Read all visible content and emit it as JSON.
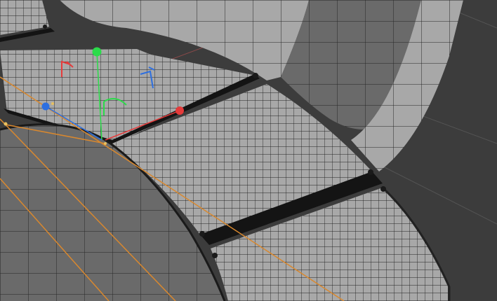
{
  "viewport": {
    "view": "3D perspective",
    "background_color": "#3c3c3c",
    "floor_grid_color": "#545454",
    "world_x_axis_color": "#8e4a4a"
  },
  "mesh": {
    "fill_color": "#a8a8a8",
    "dark_fill_color": "#6a6a6a",
    "wire_color": "#222222",
    "gap_color": "#141414"
  },
  "spline": {
    "color": "#d9882e",
    "point_color": "#e8c060"
  },
  "gizmo": {
    "x_axis_color": "#e53b3b",
    "y_axis_color": "#2bdb4a",
    "z_axis_color": "#2d6fe0",
    "x_handle_icon": "sphere-handle-icon",
    "y_handle_icon": "sphere-handle-icon",
    "z_handle_icon": "sphere-handle-icon",
    "rotation_arc_icon": "rotation-arc-icon"
  },
  "screen_axes": {
    "red_axis_icon": "axis-indicator-icon",
    "blue_axis_icon": "axis-indicator-icon"
  }
}
